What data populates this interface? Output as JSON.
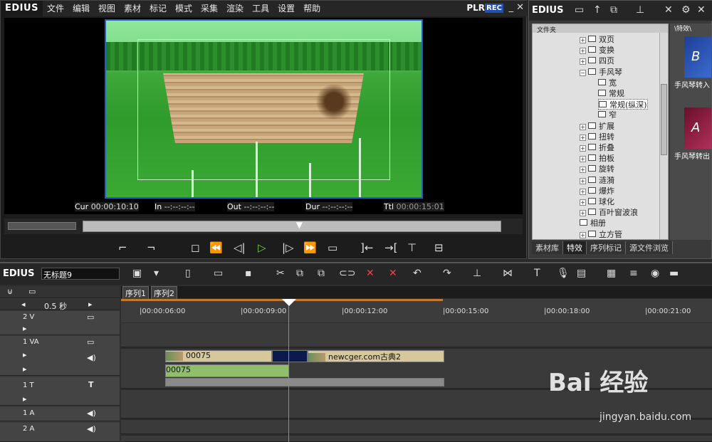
{
  "player": {
    "logo": "EDIUS",
    "menu": [
      "文件",
      "编辑",
      "视图",
      "素材",
      "标记",
      "模式",
      "采集",
      "渲染",
      "工具",
      "设置",
      "帮助"
    ],
    "plr": "PLR",
    "rec": "REC",
    "timecode": {
      "cur_label": "Cur",
      "cur": "00:00:10:10",
      "in_label": "In",
      "in": "--:--:--:--",
      "out_label": "Out",
      "out": "--:--:--:--",
      "dur_label": "Dur",
      "dur": "--:--:--:--",
      "ttl_label": "Ttl",
      "ttl": "00:00:15:01"
    },
    "scrub_position": 0.52
  },
  "library": {
    "logo": "EDIUS",
    "tree_header": "文件夹",
    "tree": [
      {
        "label": "双页",
        "expander": "+",
        "level": 1
      },
      {
        "label": "变换",
        "expander": "+",
        "level": 1
      },
      {
        "label": "四页",
        "expander": "+",
        "level": 1
      },
      {
        "label": "手风琴",
        "expander": "−",
        "level": 1,
        "open": true
      },
      {
        "label": "宽",
        "level": 2
      },
      {
        "label": "常规",
        "level": 2
      },
      {
        "label": "常规(纵深)",
        "level": 2,
        "selected": true
      },
      {
        "label": "窄",
        "level": 2
      },
      {
        "label": "扩展",
        "expander": "+",
        "level": 1
      },
      {
        "label": "扭转",
        "expander": "+",
        "level": 1
      },
      {
        "label": "折叠",
        "expander": "+",
        "level": 1
      },
      {
        "label": "拍板",
        "expander": "+",
        "level": 1
      },
      {
        "label": "旋转",
        "expander": "+",
        "level": 1
      },
      {
        "label": "涟漪",
        "expander": "+",
        "level": 1
      },
      {
        "label": "爆炸",
        "expander": "+",
        "level": 1
      },
      {
        "label": "球化",
        "expander": "+",
        "level": 1
      },
      {
        "label": "百叶窗波浪",
        "expander": "+",
        "level": 1
      },
      {
        "label": "相册",
        "level": 1
      },
      {
        "label": "立方管",
        "expander": "+",
        "level": 1
      }
    ],
    "thumbs_header": "\\特效\\",
    "thumbs": [
      {
        "label": "手风琴转入",
        "letter": "B"
      },
      {
        "label": "手风琴转出",
        "letter": "A"
      }
    ],
    "tabs": [
      "素材库",
      "特效",
      "序列标记",
      "源文件浏览"
    ]
  },
  "timeline": {
    "logo": "EDIUS",
    "project_title": "无标题9",
    "sequences": [
      "序列1",
      "序列2"
    ],
    "zoom": "0.5 秒",
    "ruler_ticks": [
      "|00:00:06:00",
      "|00:00:09:00",
      "|00:00:12:00",
      "|00:00:15:00",
      "|00:00:18:00",
      "|00:00:21:00"
    ],
    "tracks": [
      {
        "name": "2 V",
        "type": "video"
      },
      {
        "name": "1 VA",
        "type": "videoaudio"
      },
      {
        "name": "1 T",
        "type": "title"
      },
      {
        "name": "1 A",
        "type": "audio"
      },
      {
        "name": "2 A",
        "type": "audio"
      }
    ],
    "clips": {
      "video_clip_1": "00075",
      "video_clip_2": "newcger.com古典2",
      "audio_clip": "00075"
    }
  },
  "watermark": {
    "brand": "Bai 经验",
    "url": "jingyan.baidu.com"
  }
}
